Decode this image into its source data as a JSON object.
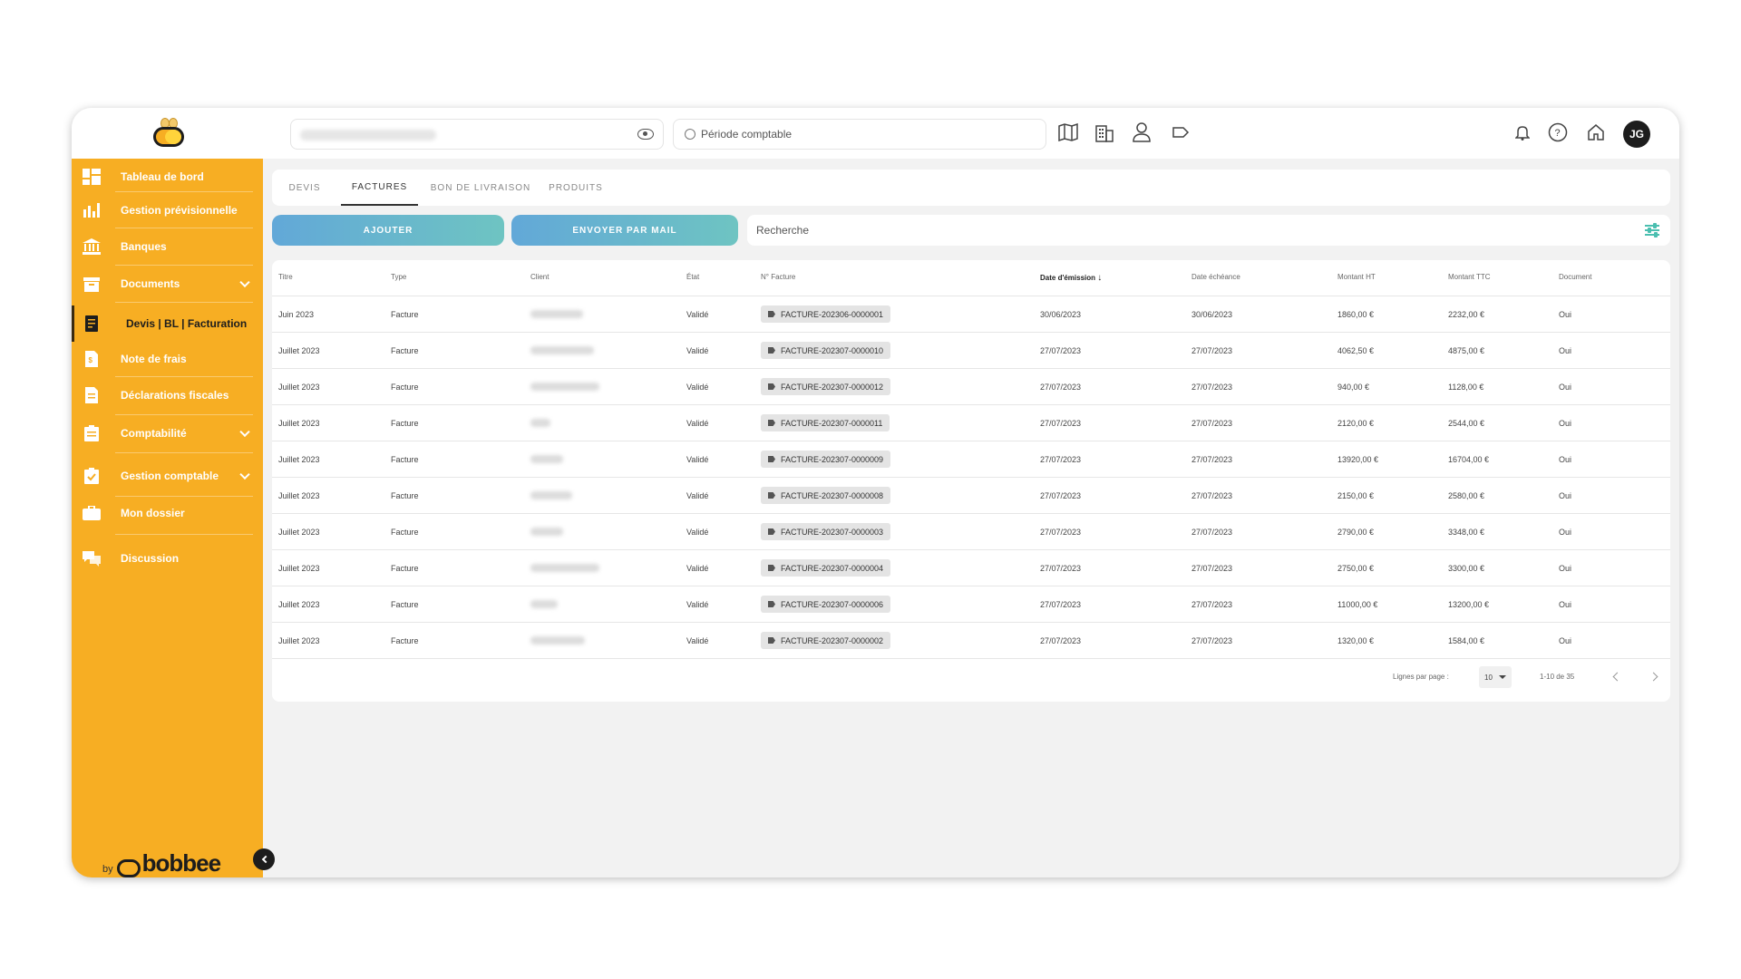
{
  "sidebar": {
    "items": [
      {
        "label": "Tableau de bord",
        "icon": "dashboard-icon"
      },
      {
        "label": "Gestion prévisionnelle",
        "icon": "bar-chart-icon"
      },
      {
        "label": "Banques",
        "icon": "bank-icon"
      },
      {
        "label": "Documents",
        "icon": "folder-icon"
      },
      {
        "label": "Devis | BL | Facturation",
        "icon": "invoice-icon"
      },
      {
        "label": "Note de frais",
        "icon": "receipt-icon"
      },
      {
        "label": "Déclarations fiscales",
        "icon": "tax-document-icon"
      },
      {
        "label": "Comptabilité",
        "icon": "clipboard-icon"
      },
      {
        "label": "Gestion comptable",
        "icon": "clipboard-check-icon"
      },
      {
        "label": "Mon dossier",
        "icon": "briefcase-icon"
      },
      {
        "label": "Discussion",
        "icon": "chat-icon"
      }
    ],
    "brand_by": "by",
    "brand_name": "bobbee"
  },
  "topbar": {
    "period_placeholder": "Période comptable",
    "avatar_initials": "JG"
  },
  "tabs": [
    "DEVIS",
    "FACTURES",
    "BON DE LIVRAISON",
    "PRODUITS"
  ],
  "actions": {
    "add_label": "AJOUTER",
    "send_label": "ENVOYER PAR MAIL",
    "search_placeholder": "Recherche"
  },
  "table": {
    "headers": [
      "Titre",
      "Type",
      "Client",
      "État",
      "N° Facture",
      "Date d'émission",
      "Date échéance",
      "Montant HT",
      "Montant TTC",
      "Document"
    ],
    "rows": [
      {
        "titre": "Juin 2023",
        "type": "Facture",
        "etat": "Validé",
        "numero": "FACTURE-202306-0000001",
        "emission": "30/06/2023",
        "echeance": "30/06/2023",
        "ht": "1860,00 €",
        "ttc": "2232,00 €",
        "doc": "Oui"
      },
      {
        "titre": "Juillet 2023",
        "type": "Facture",
        "etat": "Validé",
        "numero": "FACTURE-202307-0000010",
        "emission": "27/07/2023",
        "echeance": "27/07/2023",
        "ht": "4062,50 €",
        "ttc": "4875,00 €",
        "doc": "Oui"
      },
      {
        "titre": "Juillet 2023",
        "type": "Facture",
        "etat": "Validé",
        "numero": "FACTURE-202307-0000012",
        "emission": "27/07/2023",
        "echeance": "27/07/2023",
        "ht": "940,00 €",
        "ttc": "1128,00 €",
        "doc": "Oui"
      },
      {
        "titre": "Juillet 2023",
        "type": "Facture",
        "etat": "Validé",
        "numero": "FACTURE-202307-0000011",
        "emission": "27/07/2023",
        "echeance": "27/07/2023",
        "ht": "2120,00 €",
        "ttc": "2544,00 €",
        "doc": "Oui"
      },
      {
        "titre": "Juillet 2023",
        "type": "Facture",
        "etat": "Validé",
        "numero": "FACTURE-202307-0000009",
        "emission": "27/07/2023",
        "echeance": "27/07/2023",
        "ht": "13920,00 €",
        "ttc": "16704,00 €",
        "doc": "Oui"
      },
      {
        "titre": "Juillet 2023",
        "type": "Facture",
        "etat": "Validé",
        "numero": "FACTURE-202307-0000008",
        "emission": "27/07/2023",
        "echeance": "27/07/2023",
        "ht": "2150,00 €",
        "ttc": "2580,00 €",
        "doc": "Oui"
      },
      {
        "titre": "Juillet 2023",
        "type": "Facture",
        "etat": "Validé",
        "numero": "FACTURE-202307-0000003",
        "emission": "27/07/2023",
        "echeance": "27/07/2023",
        "ht": "2790,00 €",
        "ttc": "3348,00 €",
        "doc": "Oui"
      },
      {
        "titre": "Juillet 2023",
        "type": "Facture",
        "etat": "Validé",
        "numero": "FACTURE-202307-0000004",
        "emission": "27/07/2023",
        "echeance": "27/07/2023",
        "ht": "2750,00 €",
        "ttc": "3300,00 €",
        "doc": "Oui"
      },
      {
        "titre": "Juillet 2023",
        "type": "Facture",
        "etat": "Validé",
        "numero": "FACTURE-202307-0000006",
        "emission": "27/07/2023",
        "echeance": "27/07/2023",
        "ht": "11000,00 €",
        "ttc": "13200,00 €",
        "doc": "Oui"
      },
      {
        "titre": "Juillet 2023",
        "type": "Facture",
        "etat": "Validé",
        "numero": "FACTURE-202307-0000002",
        "emission": "27/07/2023",
        "echeance": "27/07/2023",
        "ht": "1320,00 €",
        "ttc": "1584,00 €",
        "doc": "Oui"
      }
    ]
  },
  "pagination": {
    "rows_label": "Lignes par page :",
    "rows_value": "10",
    "range": "1-10 de 35"
  },
  "colors": {
    "sidebar": "#f7ae23",
    "accent_gradient_start": "#62a8d8",
    "accent_gradient_end": "#6ec4c2"
  }
}
